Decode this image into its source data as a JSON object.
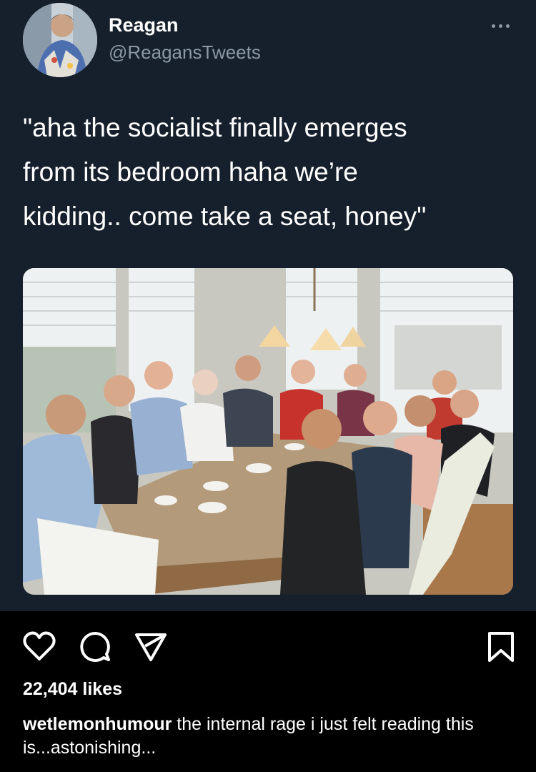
{
  "tweet": {
    "author_name": "Reagan",
    "author_handle": "@ReagansTweets",
    "text": "\"aha the socialist finally emerges\nfrom its bedroom haha we’re\nkidding.. come take a seat, honey\"",
    "more_icon": "more-horizontal-icon",
    "avatar_icon": "avatar-photo",
    "photo_icon": "family-dinner-photo"
  },
  "post": {
    "icons": [
      "heart-icon",
      "comment-icon",
      "share-icon",
      "bookmark-icon"
    ],
    "likes": "22,404 likes",
    "caption_user": "wetlemonhumour",
    "caption_text": " the internal rage i just felt reading this is...astonishing..."
  },
  "colors": {
    "tweet_background": "#16202c",
    "app_background": "#000000",
    "handle_gray": "#8b98a5"
  }
}
